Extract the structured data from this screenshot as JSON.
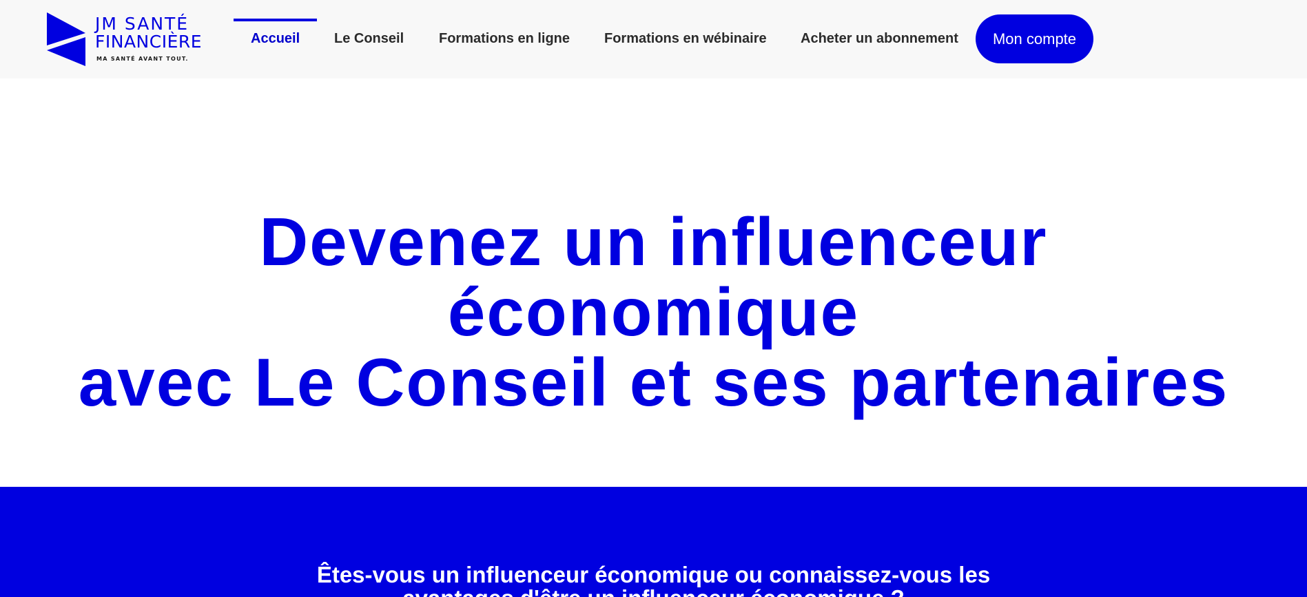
{
  "brand": {
    "name_line1": "JM SANTÉ",
    "name_line2": "FINANCIÈRE",
    "tagline": "MA SANTÉ AVANT TOUT.",
    "color": "#0000e0"
  },
  "nav": {
    "items": [
      {
        "label": "Accueil",
        "active": true
      },
      {
        "label": "Le Conseil",
        "active": false
      },
      {
        "label": "Formations en ligne",
        "active": false
      },
      {
        "label": "Formations en wébinaire",
        "active": false
      },
      {
        "label": "Acheter un abonnement",
        "active": false
      }
    ],
    "account_button": "Mon compte"
  },
  "hero": {
    "title_line1": "Devenez un influenceur",
    "title_line2": "économique",
    "title_line3": "avec Le Conseil et ses partenaires"
  },
  "section": {
    "question_line1": "Êtes-vous un influenceur économique ou connaissez-vous les",
    "question_line2": "avantages d'être un influenceur économique ?"
  },
  "colors": {
    "accent": "#0000e0",
    "header_bg": "#f8f8f8",
    "nav_text": "#2b2b2b"
  }
}
